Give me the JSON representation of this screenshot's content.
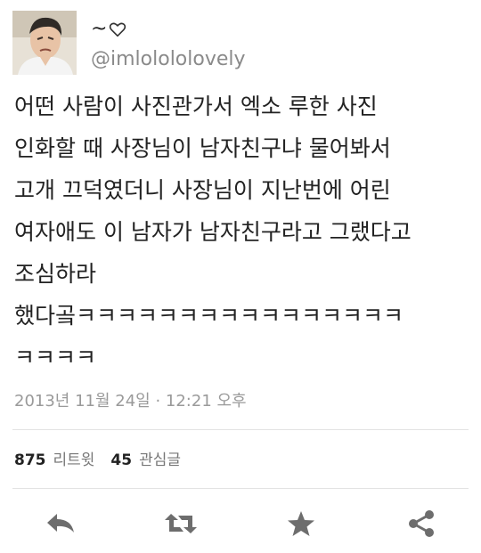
{
  "user": {
    "display_name": "~",
    "handle": "@imlolololovely"
  },
  "tweet": {
    "lines": [
      "어떤 사람이 사진관가서 엑소 루한 사진",
      "인화할 때 사장님이 남자친구냐 물어봐서",
      "고개 끄덕였더니 사장님이 지난번에 어린",
      "여자애도 이 남자가 남자친구라고 그랬다고",
      "조심하라",
      "했다곸ㅋㅋㅋㅋㅋㅋㅋㅋㅋㅋㅋㅋㅋㅋㅋㅋ",
      "ㅋㅋㅋㅋ"
    ],
    "timestamp": "2013년 11월 24일 · 12:21 오후"
  },
  "stats": {
    "retweets_count": "875",
    "retweets_label": "리트윗",
    "favorites_count": "45",
    "favorites_label": "관심글"
  },
  "actions": {
    "icons": [
      "reply-icon",
      "retweet-icon",
      "favorite-icon",
      "share-icon"
    ]
  },
  "colors": {
    "text": "#222222",
    "muted": "#8a8a8a",
    "icon": "#6d6d6d",
    "divider": "#e3e3e3"
  }
}
